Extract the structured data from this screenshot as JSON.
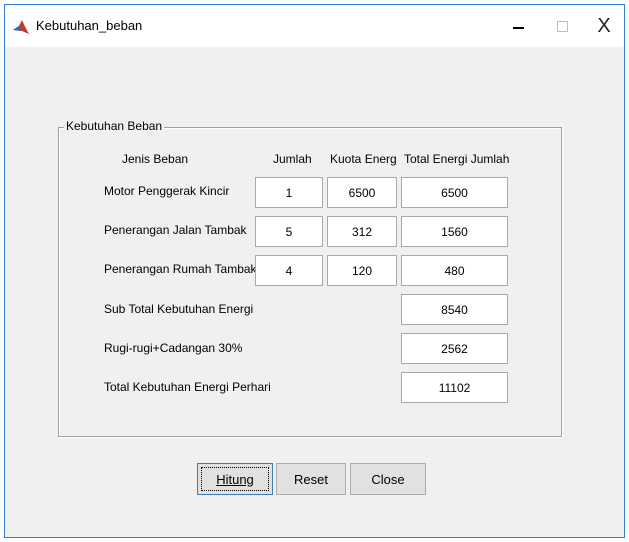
{
  "window": {
    "title": "Kebutuhan_beban",
    "controls": {
      "minimize_icon": "minimize-icon",
      "maximize_icon": "maximize-icon",
      "close_glyph": "X"
    }
  },
  "panel": {
    "title": "Kebutuhan Beban",
    "columns": {
      "jenis": "Jenis Beban",
      "jumlah": "Jumlah",
      "kuota": "Kuota Energ",
      "total": "Total Energi Jumlah"
    },
    "rows": [
      {
        "label": "Motor Penggerak Kincir",
        "jumlah": "1",
        "kuota": "6500",
        "total": "6500"
      },
      {
        "label": "Penerangan Jalan Tambak",
        "jumlah": "5",
        "kuota": "312",
        "total": "1560"
      },
      {
        "label": "Penerangan Rumah Tambak",
        "jumlah": "4",
        "kuota": "120",
        "total": "480"
      }
    ],
    "summary": [
      {
        "label": "Sub Total Kebutuhan Energi",
        "value": "8540"
      },
      {
        "label": "Rugi-rugi+Cadangan  30%",
        "value": "2562"
      },
      {
        "label": "Total Kebutuhan Energi Perhari",
        "value": "11102"
      }
    ]
  },
  "buttons": {
    "hitung": "Hitung",
    "reset": "Reset",
    "close": "Close"
  }
}
